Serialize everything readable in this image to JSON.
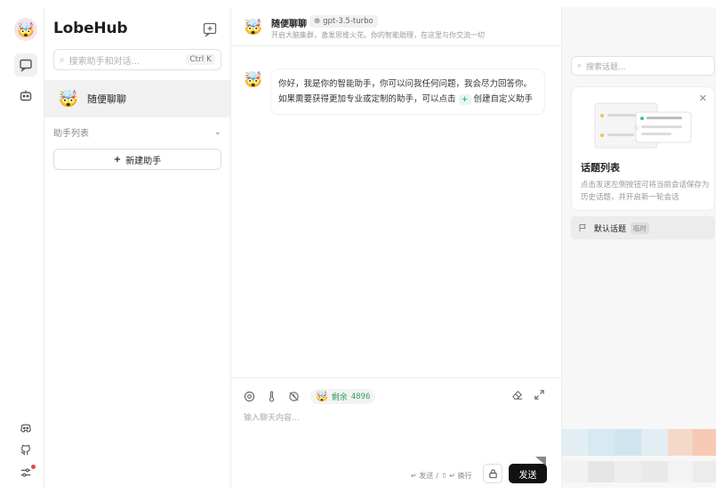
{
  "sidebar": {
    "brand": "LobeHub",
    "search_placeholder": "搜索助手和对话...",
    "search_shortcut": "Ctrl K",
    "current_session": "随便聊聊",
    "group_title": "助手列表",
    "new_agent_label": "新建助手"
  },
  "chat": {
    "title": "随便聊聊",
    "model": "gpt-3.5-turbo",
    "description": "开启大脑集群，激发思维火花。你的智能助理，在这里与你交流一切",
    "welcome_before": "你好，我是你的智能助手，你可以问我任何问题，我会尽力回答你。如果需要获得更加专业或定制的助手，可以点击",
    "welcome_plus": "+",
    "welcome_after": "创建自定义助手"
  },
  "composer": {
    "token_label": "剩余",
    "token_value": "4896",
    "placeholder": "输入聊天内容...",
    "hint_send": "↵ 发送",
    "hint_sep": "/",
    "hint_newline": "⇧ ↵ 换行",
    "send_label": "发送"
  },
  "topics": {
    "search_placeholder": "搜索话题...",
    "card_title": "话题列表",
    "card_desc": "点击发送左侧按钮可将当前会话保存为历史话题，并开启新一轮会话",
    "default_topic": "默认话题",
    "temp_tag": "临时"
  },
  "colors": {
    "accent_green": "#2e9e5b",
    "send_button": "#111111",
    "active_bg": "#f1f1f1"
  }
}
